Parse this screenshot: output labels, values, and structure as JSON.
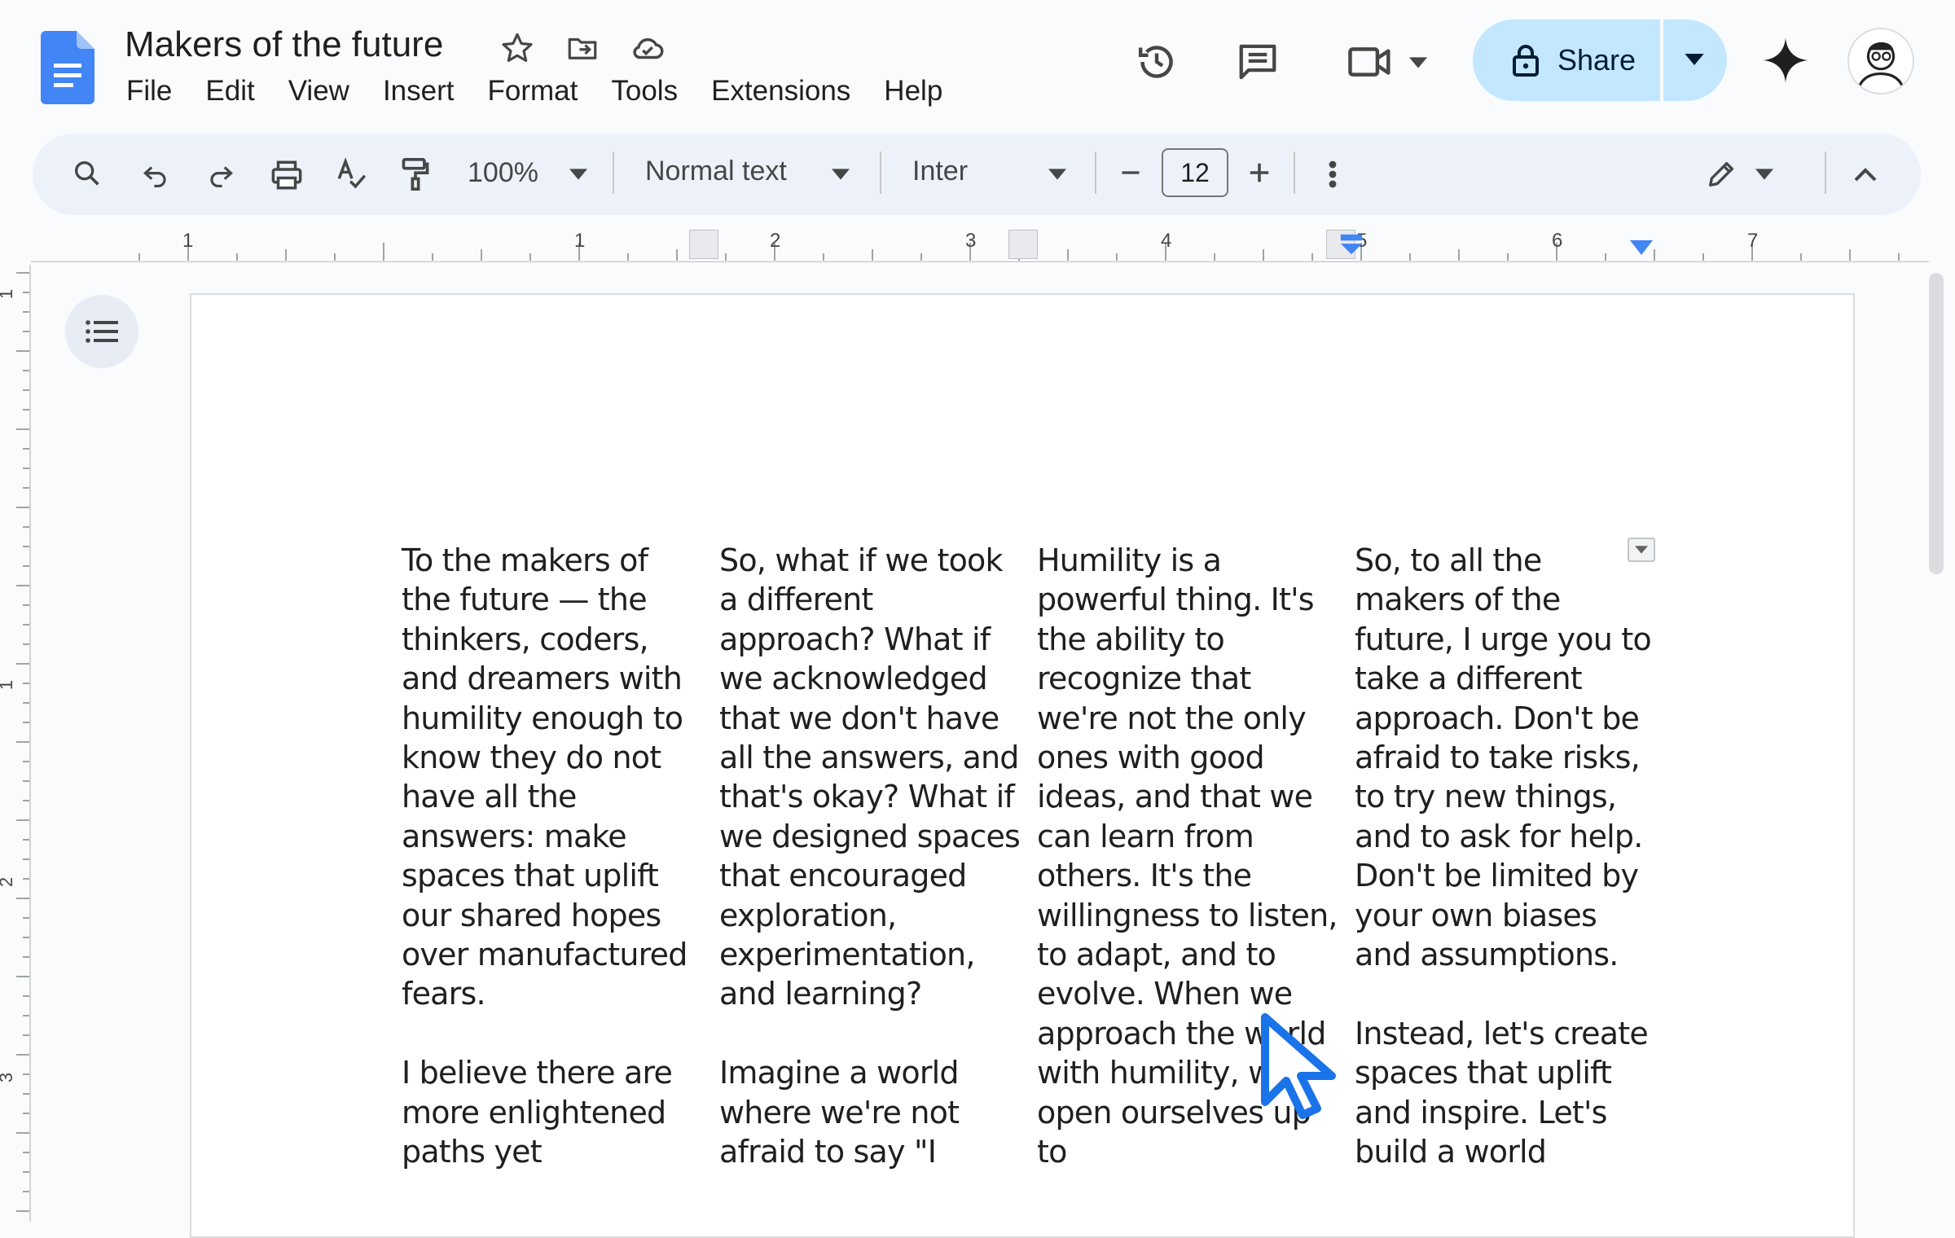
{
  "document": {
    "title": "Makers of the future"
  },
  "menu": [
    "File",
    "Edit",
    "View",
    "Insert",
    "Format",
    "Tools",
    "Extensions",
    "Help"
  ],
  "header_actions": {
    "share_label": "Share"
  },
  "toolbar": {
    "zoom": "100%",
    "style": "Normal text",
    "font": "Inter",
    "font_size": "12"
  },
  "ruler": {
    "horizontal_labels": [
      "1",
      "1",
      "2",
      "3",
      "4",
      "5",
      "6",
      "7"
    ],
    "vertical_labels": [
      "1",
      "1",
      "2",
      "3"
    ]
  },
  "columns": [
    {
      "paragraphs": [
        "To the makers of the future — the thinkers, coders, and dreamers with humility enough to know they do not have all the answers: make spaces that uplift our shared hopes over manufactured fears.",
        "I believe there are more enlightened paths yet"
      ]
    },
    {
      "paragraphs": [
        "So, what if we took a different approach? What if we acknowledged that we don't have all the answers, and that's okay? What if we designed spaces that encouraged exploration, experimentation, and learning?",
        "Imagine a world where we're not afraid to say \"I"
      ]
    },
    {
      "paragraphs": [
        "Humility is a powerful thing. It's the ability to recognize that we're not the only ones with good ideas, and that we can learn from others. It's the willingness to listen, to adapt, and to evolve. When we approach the world with humility, we open ourselves up to"
      ]
    },
    {
      "paragraphs": [
        "So, to all the makers of the future, I urge you to take a different approach. Don't be afraid to take risks, to try new things, and to ask for help. Don't be limited by your own biases and assumptions.",
        "Instead, let's create spaces that uplift and inspire. Let's build a world"
      ]
    }
  ],
  "colors": {
    "share_bg": "#c2e7ff",
    "docs_blue": "#4285f4",
    "toolbar_bg": "#edf2fa",
    "cursor_blue": "#1a73e8"
  }
}
